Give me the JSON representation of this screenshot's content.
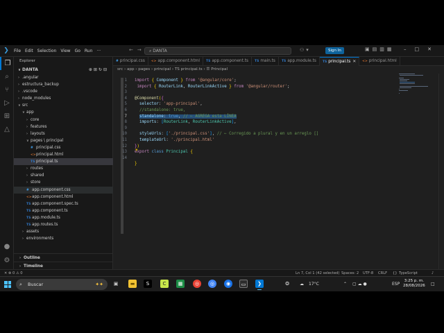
{
  "titlebar": {
    "menu": [
      "File",
      "Edit",
      "Selection",
      "View",
      "Go",
      "Run",
      "···"
    ],
    "search_text": "DANTA",
    "sign_in": "Sign In"
  },
  "explorer": {
    "title": "Explorer",
    "root": "DANTA",
    "tree": [
      {
        "label": ".angular",
        "kind": "folder",
        "depth": 0,
        "open": false
      },
      {
        "label": "estructura_backup",
        "kind": "folder",
        "depth": 0,
        "open": false
      },
      {
        "label": ".vscode",
        "kind": "folder",
        "depth": 0,
        "open": false
      },
      {
        "label": "node_modules",
        "kind": "folder",
        "depth": 0,
        "open": false
      },
      {
        "label": "src",
        "kind": "folder",
        "depth": 0,
        "open": true
      },
      {
        "label": "app",
        "kind": "folder",
        "depth": 1,
        "open": true
      },
      {
        "label": "core",
        "kind": "folder",
        "depth": 2,
        "open": false
      },
      {
        "label": "features",
        "kind": "folder",
        "depth": 2,
        "open": false
      },
      {
        "label": "layouts",
        "kind": "folder",
        "depth": 2,
        "open": false
      },
      {
        "label": "pages \\ principal",
        "kind": "folder",
        "depth": 2,
        "open": true
      },
      {
        "label": "principal.css",
        "kind": "css",
        "depth": 3
      },
      {
        "label": "principal.html",
        "kind": "html",
        "depth": 3
      },
      {
        "label": "principal.ts",
        "kind": "ts",
        "depth": 3,
        "selected": true
      },
      {
        "label": "routes",
        "kind": "folder",
        "depth": 2,
        "open": false
      },
      {
        "label": "shared",
        "kind": "folder",
        "depth": 2,
        "open": false
      },
      {
        "label": "store",
        "kind": "folder",
        "depth": 2,
        "open": false
      },
      {
        "label": "app.component.css",
        "kind": "css",
        "depth": 2,
        "hover": true
      },
      {
        "label": "app.component.html",
        "kind": "html",
        "depth": 2
      },
      {
        "label": "app.component.spec.ts",
        "kind": "ts",
        "depth": 2
      },
      {
        "label": "app.component.ts",
        "kind": "ts",
        "depth": 2
      },
      {
        "label": "app.module.ts",
        "kind": "ts",
        "depth": 2
      },
      {
        "label": "app.routes.ts",
        "kind": "ts",
        "depth": 2
      },
      {
        "label": "assets",
        "kind": "folder",
        "depth": 1,
        "open": false
      },
      {
        "label": "environments",
        "kind": "folder",
        "depth": 1,
        "open": false
      }
    ],
    "outline": "Outline",
    "timeline": "Timeline"
  },
  "tabs": [
    {
      "label": "principal.css",
      "icon": "#",
      "kind": "css"
    },
    {
      "label": "app.component.html",
      "icon": "<>",
      "kind": "html"
    },
    {
      "label": "app.component.ts",
      "icon": "TS",
      "kind": "ts"
    },
    {
      "label": "main.ts",
      "icon": "TS",
      "kind": "ts"
    },
    {
      "label": "app.module.ts",
      "icon": "TS",
      "kind": "ts"
    },
    {
      "label": "principal.ts",
      "icon": "TS",
      "kind": "ts",
      "active": true
    },
    {
      "label": "principal.html",
      "icon": "<>",
      "kind": "html"
    }
  ],
  "breadcrumb": "src › app › pages › principal › TS principal.ts › ☰ Principal",
  "code_lines": [
    "<span class=\"k\">import</span> <span class=\"p\">{</span> <span class=\"v\">Component</span> <span class=\"p\">}</span> <span class=\"k\">from</span> <span class=\"s\">'@angular/core'</span>;",
    " <span class=\"k\">import</span> <span class=\"p\">{</span> <span class=\"v\">RouterLink</span>, <span class=\"v\">RouterLinkActive</span> <span class=\"p\">}</span> <span class=\"k\">from</span> <span class=\"s\">'@angular/router'</span>;",
    "",
    "<span class=\"dec\">@Component</span><span class=\"p\">(</span><span class=\"p2\">{</span>",
    "  <span class=\"v\">selector</span>: <span class=\"s\">'app-principal'</span>,",
    "  <span class=\"c\">//standalone: true,</span>",
    "  <span class=\"hl\"><span class=\"v\">standalone</span>: <span class=\"kw\">true</span>, <span class=\"c\">// ← AGREGA esta LÍNEA</span></span>",
    "  <span class=\"v\">imports</span>: <span class=\"p3\">[</span><span class=\"t\">RouterLink</span>, <span class=\"t\">RouterLinkActive</span><span class=\"p3\">]</span>,",
    "",
    "  <span class=\"v\">styleUrls</span>: <span class=\"p3\">[</span><span class=\"s\">'./principal.css'</span><span class=\"p3\">]</span>, <span class=\"c\">// ← Corregido a plural y en un arreglo []</span>",
    "  <span class=\"v\">templateUrl</span>: <span class=\"s\">'./principal.html'</span>",
    "<span class=\"p2\">}</span><span class=\"p\">)</span>",
    "<span class=\"k\">export</span> <span class=\"kw\">class</span> <span class=\"t\">Principal</span> <span class=\"p\">{</span>",
    "",
    "<span class=\"p\">}</span>"
  ],
  "line_numbers": [
    "1",
    "2",
    "3",
    "4",
    "5",
    "6",
    "7",
    "8",
    "9",
    "10",
    "11",
    "12",
    "13",
    "14"
  ],
  "statusbar": {
    "left": "✕  ⊗ 0 ⚠ 0",
    "position": "Ln 7, Col 1 (42 selected)",
    "spaces": "Spaces: 2",
    "encoding": "UTF-8",
    "eol": "CRLF",
    "braces": "{}",
    "language": "TypeScript",
    "bell": "♪"
  },
  "taskbar": {
    "search_placeholder": "Buscar",
    "temperature": "17°C",
    "lang": "ESP",
    "time": "3:25 p. m.",
    "date": "28/08/2026"
  },
  "colors": {
    "accent": "#0078d4",
    "selection": "#264f78",
    "signin": "#0e639c"
  }
}
